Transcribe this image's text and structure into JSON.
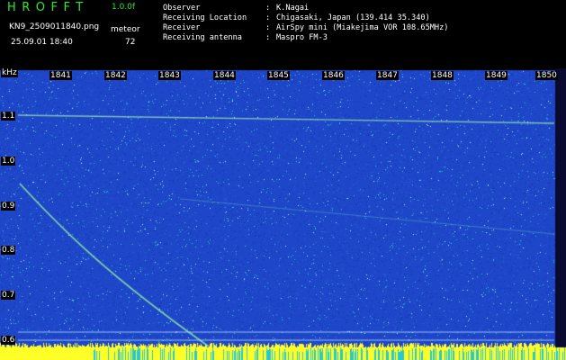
{
  "header": {
    "title": "HROFFT",
    "speed": "1.0.0f",
    "filename": "KN9_2509011840.png",
    "datetime": "25.09.01 18:40",
    "meteor_label": "meteor",
    "meteor_count": "72",
    "info": [
      {
        "key": "Observer",
        "value": "K.Nagai"
      },
      {
        "key": "Receiving Location",
        "value": "Chigasaki, Japan (139.414 35.340)"
      },
      {
        "key": "Receiver",
        "value": "AirSpy mini (Miakejima VOR 108.65MHz)"
      },
      {
        "key": "Receiving antenna",
        "value": "Maspro FM-3"
      }
    ]
  },
  "spectrogram": {
    "y_unit": "kHz",
    "y_ticks": [
      "1.1",
      "1.0",
      "0.9",
      "0.8",
      "0.7",
      "0.6"
    ],
    "x_ticks": [
      "1841",
      "1842",
      "1843",
      "1844",
      "1845",
      "1846",
      "1847",
      "1848",
      "1849",
      "1850"
    ],
    "colors": {
      "background": "#1e46c8",
      "noise": "#28c8d2",
      "trace": "#8cf0a0",
      "baseline": "#ffff28"
    }
  }
}
